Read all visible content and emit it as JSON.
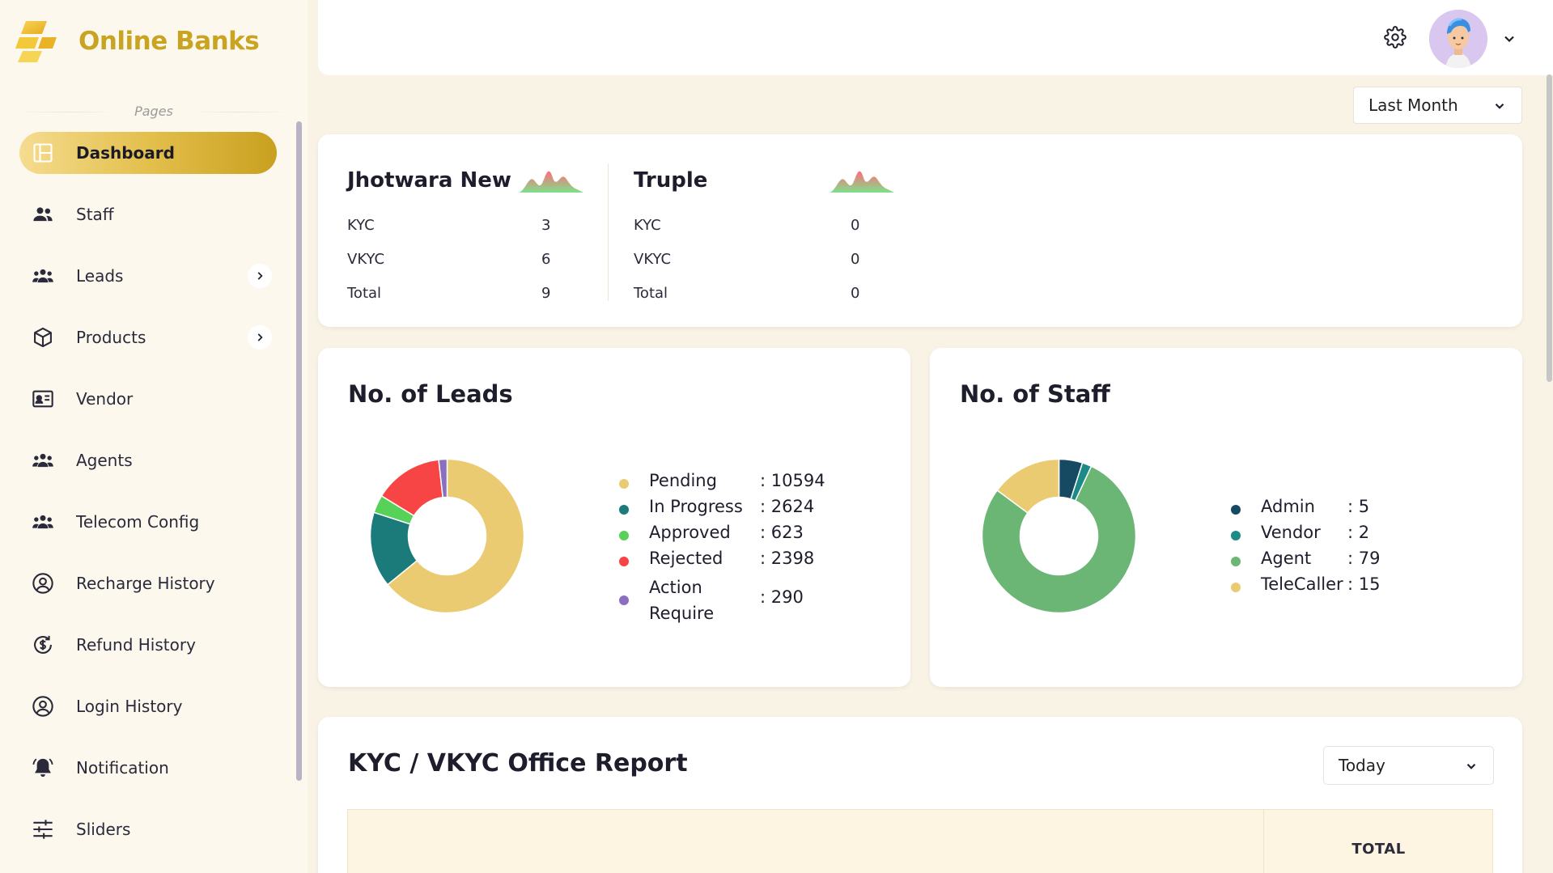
{
  "app": {
    "name": "Online Banks"
  },
  "sidebar": {
    "section_label": "Pages",
    "items": [
      {
        "label": "Dashboard",
        "icon": "dashboard-icon",
        "active": true,
        "has_submenu": false
      },
      {
        "label": "Staff",
        "icon": "staff-icon",
        "active": false,
        "has_submenu": false
      },
      {
        "label": "Leads",
        "icon": "leads-icon",
        "active": false,
        "has_submenu": true
      },
      {
        "label": "Products",
        "icon": "products-icon",
        "active": false,
        "has_submenu": true
      },
      {
        "label": "Vendor",
        "icon": "vendor-icon",
        "active": false,
        "has_submenu": false
      },
      {
        "label": "Agents",
        "icon": "agents-icon",
        "active": false,
        "has_submenu": false
      },
      {
        "label": "Telecom Config",
        "icon": "telecom-config-icon",
        "active": false,
        "has_submenu": false
      },
      {
        "label": "Recharge History",
        "icon": "recharge-history-icon",
        "active": false,
        "has_submenu": false
      },
      {
        "label": "Refund History",
        "icon": "refund-history-icon",
        "active": false,
        "has_submenu": false
      },
      {
        "label": "Login History",
        "icon": "login-history-icon",
        "active": false,
        "has_submenu": false
      },
      {
        "label": "Notification",
        "icon": "notification-icon",
        "active": false,
        "has_submenu": false
      },
      {
        "label": "Sliders",
        "icon": "sliders-icon",
        "active": false,
        "has_submenu": false
      }
    ]
  },
  "header": {
    "settings_icon": "gear-icon",
    "avatar_icon": "avatar",
    "menu_icon": "chevron-down-icon"
  },
  "filters": {
    "range": "Last Month",
    "report_range": "Today"
  },
  "offices": [
    {
      "name": "Jhotwara New",
      "rows": [
        {
          "label": "KYC",
          "value": "3"
        },
        {
          "label": "VKYC",
          "value": "6"
        },
        {
          "label": "Total",
          "value": "9"
        }
      ]
    },
    {
      "name": "Truple",
      "rows": [
        {
          "label": "KYC",
          "value": "0"
        },
        {
          "label": "VKYC",
          "value": "0"
        },
        {
          "label": "Total",
          "value": "0"
        }
      ]
    }
  ],
  "leads": {
    "title": "No. of Leads",
    "items": [
      {
        "label": "Pending",
        "value": ": 10594",
        "count": 10594,
        "color": "#ebcb71"
      },
      {
        "label": "In Progress",
        "value": ": 2624",
        "count": 2624,
        "color": "#1b7b7b"
      },
      {
        "label": "Approved",
        "value": ": 623",
        "count": 623,
        "color": "#57d157"
      },
      {
        "label": "Rejected",
        "value": ": 2398",
        "count": 2398,
        "color": "#f74545"
      },
      {
        "label": "Action Require",
        "value": ": 290",
        "count": 290,
        "color": "#8a6fbf"
      }
    ]
  },
  "staff": {
    "title": "No. of Staff",
    "items": [
      {
        "label": "Admin",
        "value": ": 5",
        "count": 5,
        "color": "#164a63"
      },
      {
        "label": "Vendor",
        "value": ": 2",
        "count": 2,
        "color": "#1c8a86"
      },
      {
        "label": "Agent",
        "value": ": 79",
        "count": 79,
        "color": "#6bb575"
      },
      {
        "label": "TeleCaller",
        "value": ": 15",
        "count": 15,
        "color": "#ebcb71"
      }
    ]
  },
  "chart_data": [
    {
      "type": "pie",
      "title": "No. of Leads",
      "categories": [
        "Pending",
        "In Progress",
        "Approved",
        "Rejected",
        "Action Require"
      ],
      "values": [
        10594,
        2624,
        623,
        2398,
        290
      ]
    },
    {
      "type": "pie",
      "title": "No. of Staff",
      "categories": [
        "Admin",
        "Vendor",
        "Agent",
        "TeleCaller"
      ],
      "values": [
        5,
        2,
        79,
        15
      ]
    }
  ],
  "report": {
    "title": "KYC / VKYC Office Report",
    "column_total": "TOTAL"
  },
  "colors": {
    "accent": "#c9a423",
    "background": "#f9f3e6",
    "active_nav_start": "#f5dc8f",
    "active_nav_end": "#c9a01f"
  }
}
